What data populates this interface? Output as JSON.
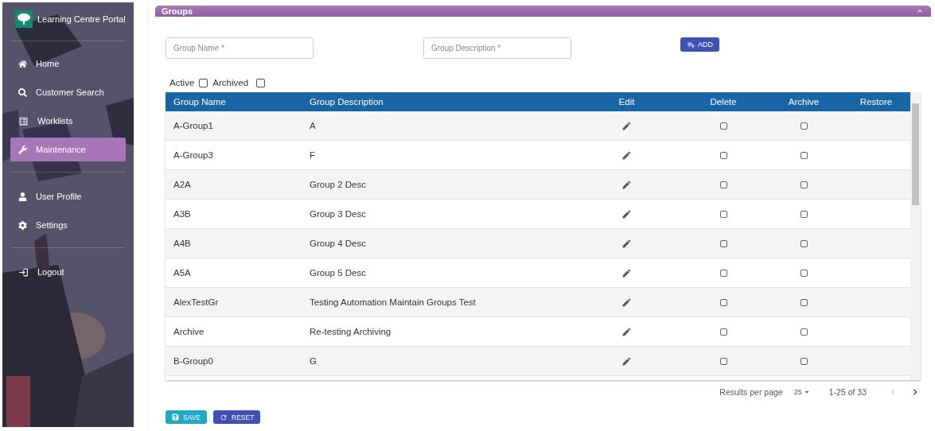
{
  "app": {
    "title": "Learning Centre Portal"
  },
  "nav": [
    {
      "label": "Home",
      "selected": false,
      "divider_after": false
    },
    {
      "label": "Customer Search",
      "selected": false,
      "divider_after": false
    },
    {
      "label": "Worklists",
      "selected": false,
      "divider_after": false
    },
    {
      "label": "Maintenance",
      "selected": true,
      "divider_after": true
    },
    {
      "label": "User Profile",
      "selected": false,
      "divider_after": false
    },
    {
      "label": "Settings",
      "selected": false,
      "divider_after": true
    },
    {
      "label": "Logout",
      "selected": false,
      "divider_after": false
    }
  ],
  "panel": {
    "title": "Groups",
    "expanded": true
  },
  "form": {
    "name_placeholder": "Group Name *",
    "description_placeholder": "Group Description *",
    "add_label": "ADD"
  },
  "filters": [
    {
      "label": "Active",
      "checked": false
    },
    {
      "label": "Archived",
      "checked": false
    }
  ],
  "table": {
    "columns": [
      "Group Name",
      "Group Description",
      "Edit",
      "Delete",
      "Archive",
      "Restore"
    ],
    "rows": [
      {
        "name": "A-Group1",
        "description": "A",
        "delete": false,
        "archive": false
      },
      {
        "name": "A-Group3",
        "description": "F",
        "delete": false,
        "archive": false
      },
      {
        "name": "A2A",
        "description": "Group 2 Desc",
        "delete": false,
        "archive": false
      },
      {
        "name": "A3B",
        "description": "Group 3 Desc",
        "delete": false,
        "archive": false
      },
      {
        "name": "A4B",
        "description": "Group 4 Desc",
        "delete": false,
        "archive": false
      },
      {
        "name": "A5A",
        "description": "Group 5 Desc",
        "delete": false,
        "archive": false
      },
      {
        "name": "AlexTestGr",
        "description": "Testing Automation Maintain Groups Test",
        "delete": false,
        "archive": false
      },
      {
        "name": "Archive",
        "description": "Re-testing Archiving",
        "delete": false,
        "archive": false
      },
      {
        "name": "B-Group0",
        "description": "G",
        "delete": false,
        "archive": false
      }
    ]
  },
  "pagination": {
    "label": "Results per page",
    "per_page": "25",
    "range": "1-25 of 33",
    "prev_disabled": true,
    "next_disabled": false
  },
  "actions": {
    "save": "SAVE",
    "reset": "RESET"
  }
}
